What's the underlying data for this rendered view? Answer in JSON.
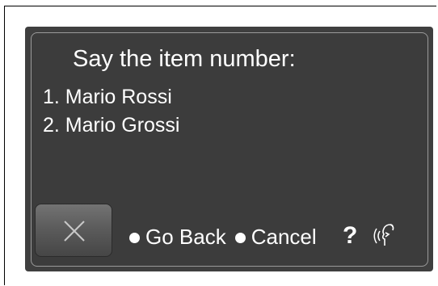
{
  "prompt": {
    "title": "Say the item number:"
  },
  "items": [
    {
      "label": "1. Mario Rossi"
    },
    {
      "label": "2. Mario Grossi"
    }
  ],
  "commands": [
    {
      "label": "Go Back"
    },
    {
      "label": "Cancel"
    }
  ],
  "help": {
    "symbol": "?"
  },
  "icons": {
    "close": "close-icon",
    "help": "question-mark-icon",
    "voice": "voice-speaking-icon"
  },
  "colors": {
    "screen_background": "#3c3c3c",
    "text": "#ffffff",
    "panel_border": "#9a9a9a"
  }
}
